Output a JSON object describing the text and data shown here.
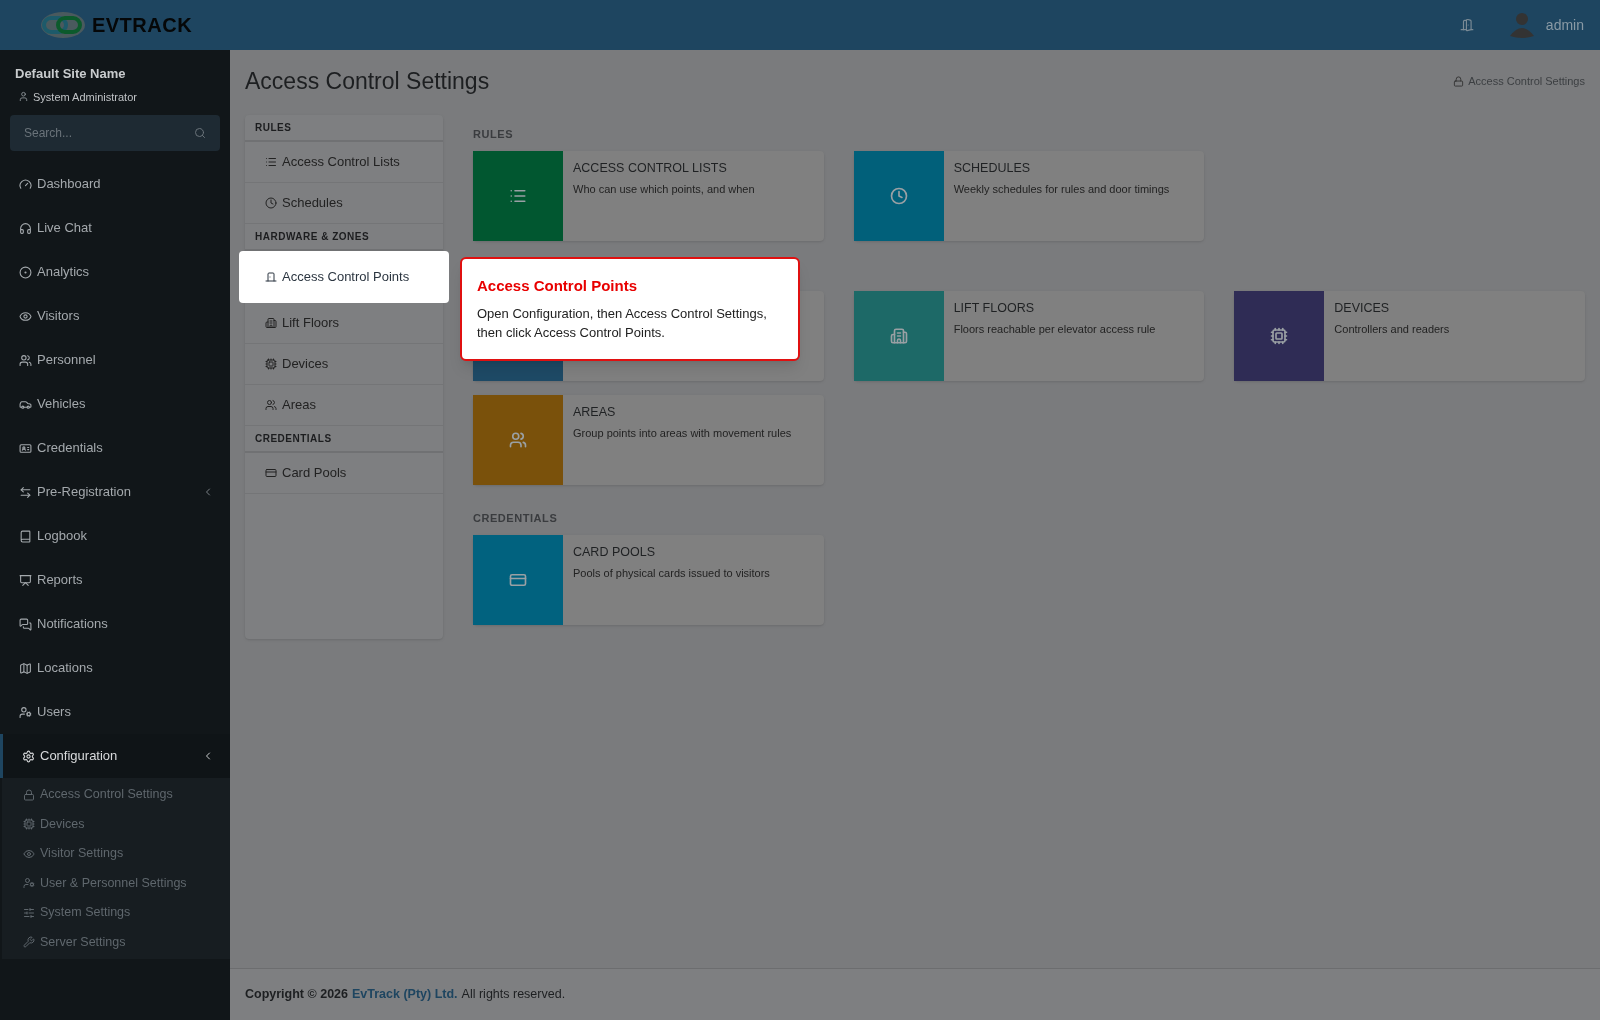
{
  "header": {
    "logo": "**EV**TRACK",
    "user": "admin"
  },
  "sidebar": {
    "site_name": "Default Site Name",
    "role": "System Administrator",
    "search": {
      "placeholder": "Search..."
    },
    "items": [
      {
        "label": "Dashboard",
        "selected": false
      },
      {
        "label": "Live Chat",
        "selected": false
      },
      {
        "label": "Analytics",
        "selected": false
      },
      {
        "label": "Visitors",
        "selected": false
      },
      {
        "label": "Personnel",
        "selected": false
      },
      {
        "label": "Vehicles",
        "selected": false
      },
      {
        "label": "Credentials",
        "selected": false
      },
      {
        "label": "Pre-Registration",
        "selected": false,
        "expanded": false
      },
      {
        "label": "Logbook",
        "selected": false
      },
      {
        "label": "Reports",
        "selected": false
      },
      {
        "label": "Notifications",
        "selected": false
      },
      {
        "label": "Locations",
        "selected": false
      },
      {
        "label": "Users",
        "selected": false
      },
      {
        "label": "Configuration",
        "selected": true,
        "expanded": true,
        "children": [
          {
            "label": "Access Control Settings"
          },
          {
            "label": "Devices"
          },
          {
            "label": "Visitor Settings"
          },
          {
            "label": "User & Personnel Settings"
          },
          {
            "label": "System Settings"
          },
          {
            "label": "Server Settings"
          }
        ]
      }
    ]
  },
  "page": {
    "title": "Access Control Settings",
    "breadcrumb": "Access Control Settings"
  },
  "nav": [
    {
      "heading": "RULES",
      "items": [
        {
          "label": "Access Control Lists",
          "selected": false
        },
        {
          "label": "Schedules",
          "selected": false
        }
      ]
    },
    {
      "heading": "HARDWARE & ZONES",
      "items": [
        {
          "label": "Access Control Points",
          "selected": true
        },
        {
          "label": "Lift Floors",
          "selected": false
        },
        {
          "label": "Devices",
          "selected": false
        },
        {
          "label": "Areas",
          "selected": false
        }
      ]
    },
    {
      "heading": "CREDENTIALS",
      "items": [
        {
          "label": "Card Pools",
          "selected": false
        }
      ]
    }
  ],
  "sections": [
    {
      "heading": "RULES",
      "rows": [
        [
          {
            "title": "ACCESS CONTROL LISTS",
            "description": "Who can use which points, and when",
            "color": "#015730"
          },
          {
            "title": "SCHEDULES",
            "description": "Weekly schedules for rules and door timings",
            "color": "#01607a"
          }
        ]
      ]
    },
    {
      "rows": [
        [
          {
            "color": "#1e4a66"
          },
          {
            "title": "LIFT FLOORS",
            "description": "Floors reachable per elevator access rule",
            "color": "#1d6967"
          },
          {
            "title": "DEVICES",
            "description": "Controllers and readers",
            "color": "#2f2c55"
          }
        ],
        [
          {
            "title": "AREAS",
            "description": "Group points into areas with movement rules",
            "color": "#7a510b"
          }
        ]
      ]
    },
    {
      "heading": "CREDENTIALS",
      "rows": [
        [
          {
            "title": "CARD POOLS",
            "description": "Pools of physical cards issued to visitors",
            "color": "#01627f"
          }
        ]
      ]
    }
  ],
  "tooltip": {
    "title": "Access Control Points",
    "text": "Open Configuration, then Access Control Settings, then click Access Control Points."
  },
  "footer": {
    "copyright": "Copyright © 2026",
    "company": "EvTrack (Pty) Ltd.",
    "rights": "All rights reserved."
  }
}
